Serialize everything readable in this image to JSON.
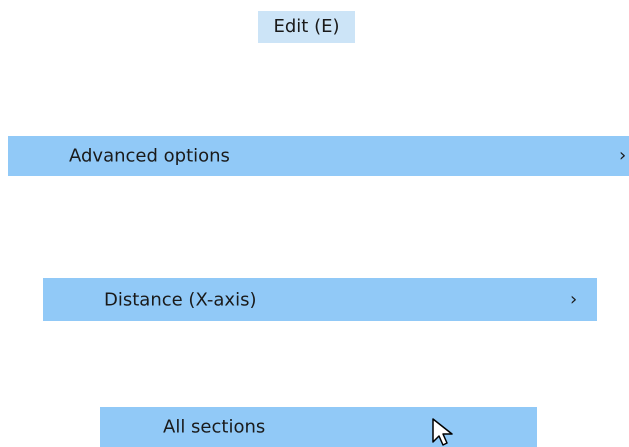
{
  "menu_bar": {
    "edit_label": "Edit (E)"
  },
  "menus": {
    "advanced_options": {
      "label": "Advanced options",
      "submenu_arrow": "›"
    },
    "distance": {
      "label": "Distance (X-axis)",
      "submenu_arrow": "›"
    },
    "all_sections": {
      "label": "All sections"
    }
  },
  "colors": {
    "highlight": "#91c9f7",
    "menubar_highlight": "#cce4f7",
    "text": "#1a1a1a"
  },
  "icons": {
    "cursor": "mouse-pointer-icon",
    "submenu": "chevron-right-icon"
  }
}
